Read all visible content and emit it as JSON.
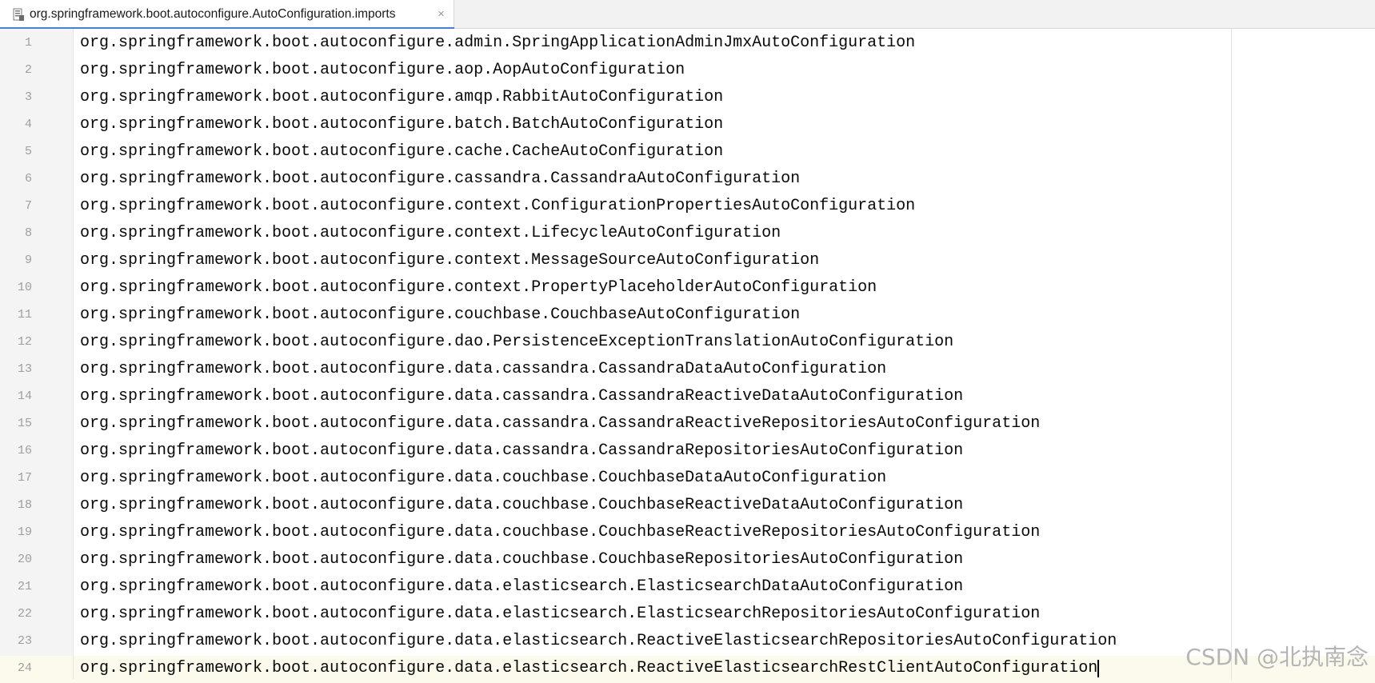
{
  "tab": {
    "title": "org.springframework.boot.autoconfigure.AutoConfiguration.imports",
    "close_symbol": "×",
    "icon": "properties-file-icon"
  },
  "editor": {
    "current_line": 24,
    "lines": [
      {
        "num": "1",
        "text": "org.springframework.boot.autoconfigure.admin.SpringApplicationAdminJmxAutoConfiguration"
      },
      {
        "num": "2",
        "text": "org.springframework.boot.autoconfigure.aop.AopAutoConfiguration"
      },
      {
        "num": "3",
        "text": "org.springframework.boot.autoconfigure.amqp.RabbitAutoConfiguration"
      },
      {
        "num": "4",
        "text": "org.springframework.boot.autoconfigure.batch.BatchAutoConfiguration"
      },
      {
        "num": "5",
        "text": "org.springframework.boot.autoconfigure.cache.CacheAutoConfiguration"
      },
      {
        "num": "6",
        "text": "org.springframework.boot.autoconfigure.cassandra.CassandraAutoConfiguration"
      },
      {
        "num": "7",
        "text": "org.springframework.boot.autoconfigure.context.ConfigurationPropertiesAutoConfiguration"
      },
      {
        "num": "8",
        "text": "org.springframework.boot.autoconfigure.context.LifecycleAutoConfiguration"
      },
      {
        "num": "9",
        "text": "org.springframework.boot.autoconfigure.context.MessageSourceAutoConfiguration"
      },
      {
        "num": "10",
        "text": "org.springframework.boot.autoconfigure.context.PropertyPlaceholderAutoConfiguration"
      },
      {
        "num": "11",
        "text": "org.springframework.boot.autoconfigure.couchbase.CouchbaseAutoConfiguration"
      },
      {
        "num": "12",
        "text": "org.springframework.boot.autoconfigure.dao.PersistenceExceptionTranslationAutoConfiguration"
      },
      {
        "num": "13",
        "text": "org.springframework.boot.autoconfigure.data.cassandra.CassandraDataAutoConfiguration"
      },
      {
        "num": "14",
        "text": "org.springframework.boot.autoconfigure.data.cassandra.CassandraReactiveDataAutoConfiguration"
      },
      {
        "num": "15",
        "text": "org.springframework.boot.autoconfigure.data.cassandra.CassandraReactiveRepositoriesAutoConfiguration"
      },
      {
        "num": "16",
        "text": "org.springframework.boot.autoconfigure.data.cassandra.CassandraRepositoriesAutoConfiguration"
      },
      {
        "num": "17",
        "text": "org.springframework.boot.autoconfigure.data.couchbase.CouchbaseDataAutoConfiguration"
      },
      {
        "num": "18",
        "text": "org.springframework.boot.autoconfigure.data.couchbase.CouchbaseReactiveDataAutoConfiguration"
      },
      {
        "num": "19",
        "text": "org.springframework.boot.autoconfigure.data.couchbase.CouchbaseReactiveRepositoriesAutoConfiguration"
      },
      {
        "num": "20",
        "text": "org.springframework.boot.autoconfigure.data.couchbase.CouchbaseRepositoriesAutoConfiguration"
      },
      {
        "num": "21",
        "text": "org.springframework.boot.autoconfigure.data.elasticsearch.ElasticsearchDataAutoConfiguration"
      },
      {
        "num": "22",
        "text": "org.springframework.boot.autoconfigure.data.elasticsearch.ElasticsearchRepositoriesAutoConfiguration"
      },
      {
        "num": "23",
        "text": "org.springframework.boot.autoconfigure.data.elasticsearch.ReactiveElasticsearchRepositoriesAutoConfiguration"
      },
      {
        "num": "24",
        "text": "org.springframework.boot.autoconfigure.data.elasticsearch.ReactiveElasticsearchRestClientAutoConfiguration"
      }
    ]
  },
  "watermark": "CSDN @北执南念"
}
